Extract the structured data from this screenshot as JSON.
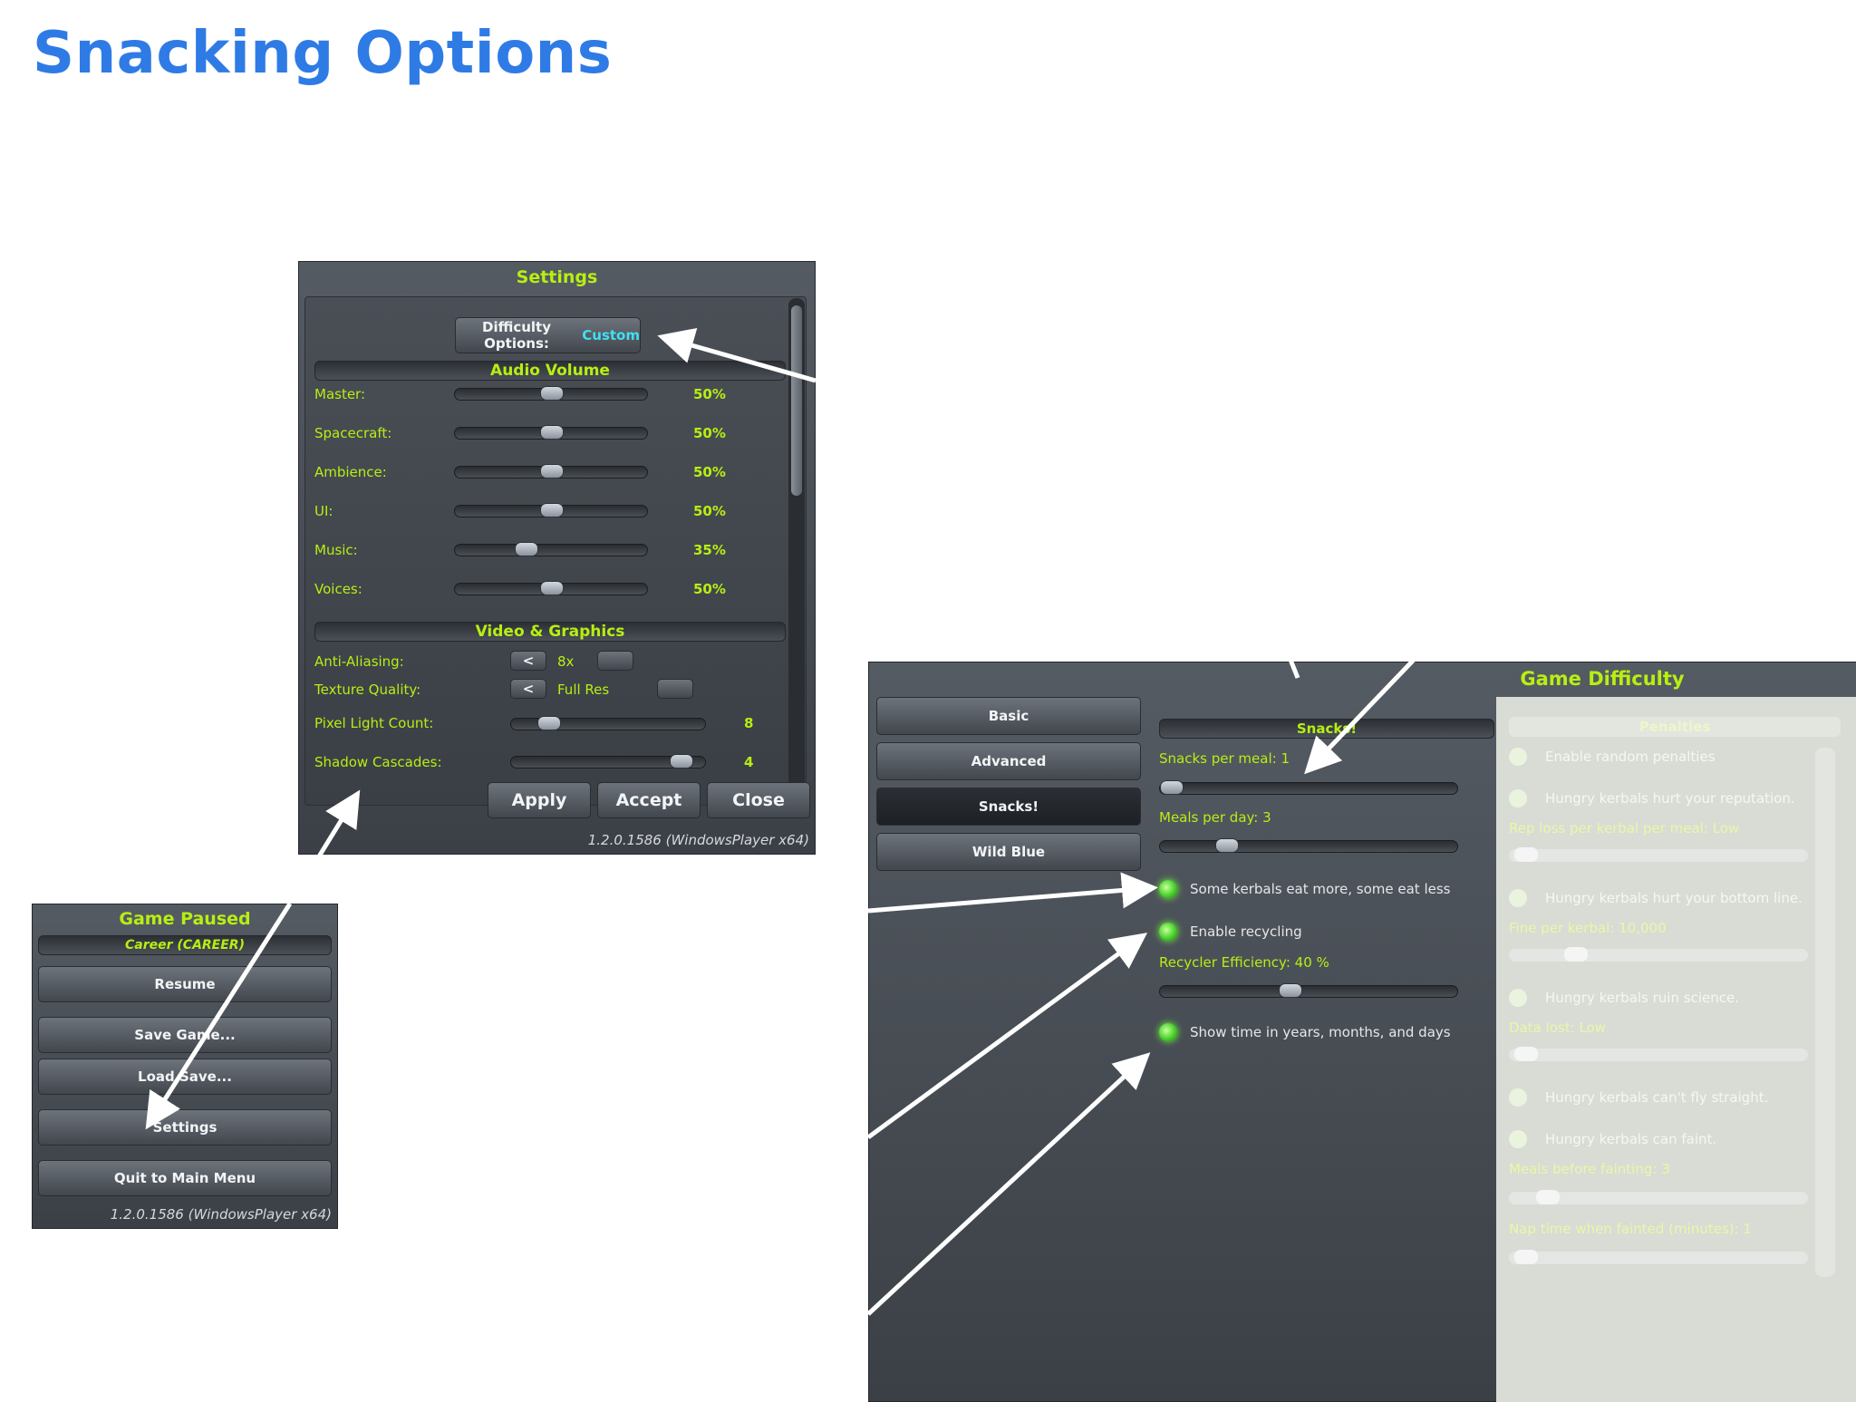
{
  "title": "Snacking Options",
  "settings": {
    "title": "Settings",
    "difficulty_label": "Difficulty Options:",
    "difficulty_value": "Custom",
    "audio_heading": "Audio Volume",
    "audio": [
      {
        "label": "Master:",
        "value": "50%",
        "level": 0.5
      },
      {
        "label": "Spacecraft:",
        "value": "50%",
        "level": 0.5
      },
      {
        "label": "Ambience:",
        "value": "50%",
        "level": 0.5
      },
      {
        "label": "UI:",
        "value": "50%",
        "level": 0.5
      },
      {
        "label": "Music:",
        "value": "35%",
        "level": 0.35
      },
      {
        "label": "Voices:",
        "value": "50%",
        "level": 0.5
      }
    ],
    "video_heading": "Video & Graphics",
    "anti_aliasing": {
      "label": "Anti-Aliasing:",
      "prev": "<",
      "value": "8x"
    },
    "texture_quality": {
      "label": "Texture Quality:",
      "prev": "<",
      "value": "Full Res"
    },
    "pixel_light": {
      "label": "Pixel Light Count:",
      "value": "8",
      "level": 0.15
    },
    "shadow_cascades": {
      "label": "Shadow Cascades:",
      "value": "4",
      "level": 0.92
    },
    "buttons": {
      "apply": "Apply",
      "accept": "Accept",
      "close": "Close"
    },
    "version": "1.2.0.1586 (WindowsPlayer x64)"
  },
  "paused": {
    "title": "Game Paused",
    "mode": "Career (CAREER)",
    "resume": "Resume",
    "save": "Save Game...",
    "load": "Load Save...",
    "settings": "Settings",
    "quit": "Quit to Main Menu",
    "version": "1.2.0.1586 (WindowsPlayer x64)"
  },
  "difficulty": {
    "title": "Game Difficulty",
    "tabs": {
      "basic": "Basic",
      "advanced": "Advanced",
      "snacks": "Snacks!",
      "wild_blue": "Wild Blue"
    },
    "snacks_heading": "Snacks!",
    "snacks_per_meal": {
      "label": "Snacks per meal: 1",
      "level": 0.0
    },
    "meals_per_day": {
      "label": "Meals per day: 3",
      "level": 0.2
    },
    "eat_more_less": "Some kerbals eat more, some eat less",
    "enable_recycling": "Enable recycling",
    "recycler": {
      "label": "Recycler Efficiency: 40 %",
      "level": 0.43
    },
    "show_time": "Show time in years, months, and days",
    "penalties": {
      "heading": "Penalties",
      "random": "Enable random penalties",
      "reputation": "Hungry kerbals hurt your reputation.",
      "rep_loss": {
        "label": "Rep loss per kerbal per meal: Low",
        "level": 0.02
      },
      "bottom_line": "Hungry kerbals hurt your bottom line.",
      "fine": {
        "label": "Fine per kerbal: 10,000",
        "level": 0.2
      },
      "science": "Hungry kerbals ruin science.",
      "data_lost": {
        "label": "Data lost: Low",
        "level": 0.02
      },
      "fly_straight": "Hungry kerbals can't fly straight.",
      "faint": "Hungry kerbals can faint.",
      "meals_before": {
        "label": "Meals before fainting: 3",
        "level": 0.1
      },
      "nap_time": {
        "label": "Nap time when fainted (minutes): 1",
        "level": 0.02
      }
    }
  }
}
